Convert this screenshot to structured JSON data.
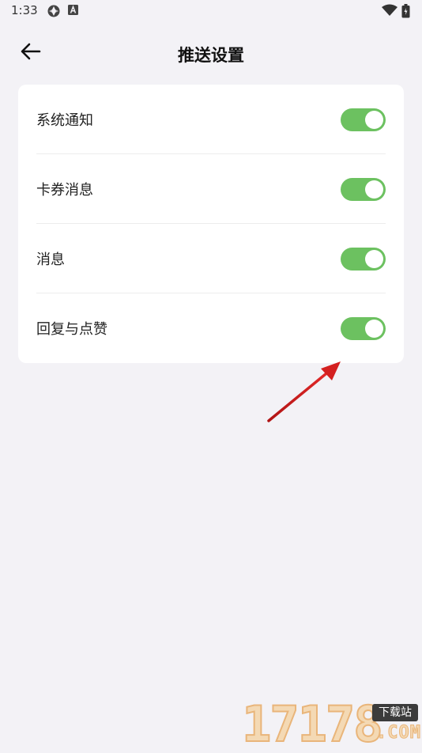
{
  "status_bar": {
    "time": "1:33",
    "icons": [
      "app-icon",
      "text-a-icon",
      "wifi-icon",
      "battery-icon"
    ]
  },
  "header": {
    "back_icon": "arrow-left-icon",
    "title": "推送设置"
  },
  "settings": [
    {
      "label": "系统通知",
      "enabled": true
    },
    {
      "label": "卡券消息",
      "enabled": true
    },
    {
      "label": "消息",
      "enabled": true
    },
    {
      "label": "回复与点赞",
      "enabled": true
    }
  ],
  "colors": {
    "background": "#f3f2f6",
    "card": "#ffffff",
    "toggle_on": "#6cc160",
    "annotation_arrow": "#d42020"
  },
  "watermark": {
    "number": "17178",
    "badge": "下载站",
    "domain": ".COM"
  }
}
